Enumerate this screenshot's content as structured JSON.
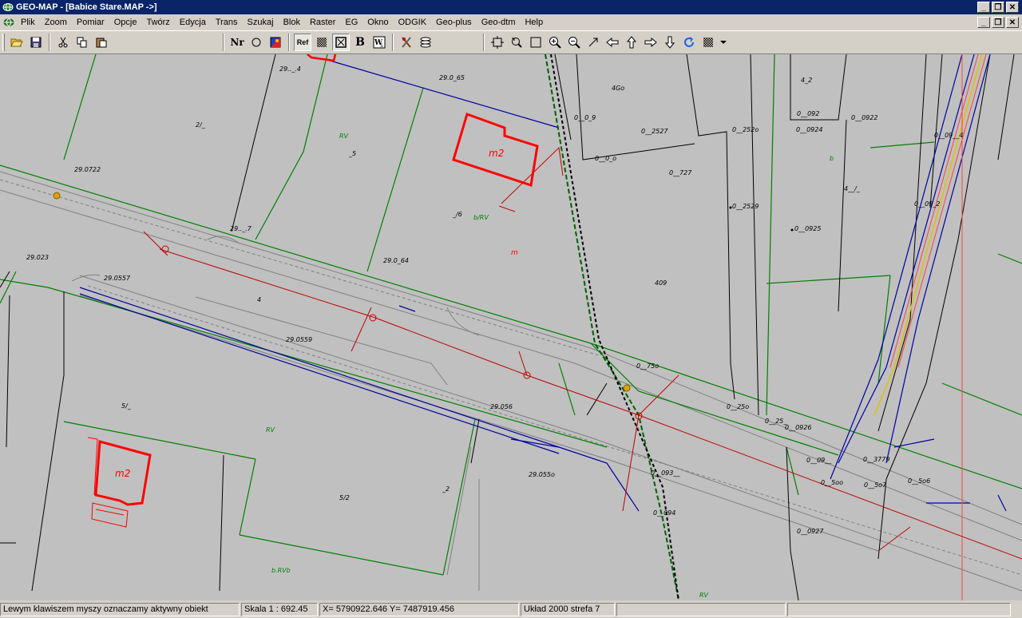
{
  "window": {
    "title": "GEO-MAP - [Babice Stare.MAP ->]"
  },
  "menu": [
    "Plik",
    "Zoom",
    "Pomiar",
    "Opcje",
    "Twórz",
    "Edycja",
    "Trans",
    "Szukaj",
    "Blok",
    "Raster",
    "EG",
    "Okno",
    "ODGIK",
    "Geo-plus",
    "Geo-dtm",
    "Help"
  ],
  "toolbar": {
    "nr_label": "Nr",
    "ref_label": "Ref",
    "b_label": "B"
  },
  "map_labels": {
    "p1": "29.._.4",
    "p2": "29.0_65",
    "p3": "2/_",
    "p4": "29.0722",
    "p5": "_5",
    "p6": "_/6",
    "p7": "29.0_64",
    "p8": "29.023",
    "p9": "29.0557",
    "p10": "29.0559",
    "p11": "4",
    "p12": "5/_",
    "p13": "5/2",
    "p14": "_2",
    "p15": "29.055o",
    "p16": "29.056",
    "p17": "409",
    "p18": "4Go",
    "p19": "0__0_9",
    "p20": "0__2527",
    "p21": "0__252o",
    "p22": "0__0_o",
    "p23": "0__727",
    "p24": "0__2529",
    "p25": "0__0925",
    "p26": "4_2",
    "p27": "0__092",
    "p28": "0__0924",
    "p29": "0__0922",
    "p30": "4__/_",
    "p31": "0__09__4",
    "p32": "0__09_2",
    "p33": "0__75o",
    "p34": "0__25o",
    "p35": "0__25_",
    "p36": "0__0926",
    "p37": "0__09__",
    "p38": "0__5oo",
    "p39": "0__5o7",
    "p40": "0__5o6",
    "p41": "0__3779",
    "p42": "0__0927",
    "p43": "0__094",
    "p44": "0__093__",
    "p45": "29.._.7"
  },
  "map_codes": {
    "rv": "RV",
    "brv": "b/RV",
    "b": "b",
    "m": "m",
    "m2a": "m2",
    "m2b": "m2",
    "brvb": "b.RVb",
    "rv2": "RV",
    "rv3": "RV"
  },
  "status": {
    "hint": "Lewym klawiszem myszy oznaczamy aktywny obiekt",
    "scale": "Skala 1 : 692.45",
    "coords": "X=  5790922.646  Y=  7487919.456",
    "system": "Układ 2000 strefa 7"
  },
  "colors": {
    "title_bg": "#0a246a",
    "map_bg": "#c0c0c0",
    "parcel_line": "#000000",
    "boundary_green": "#008000",
    "utility_red": "#c00000",
    "building_red": "#ff0000",
    "road_blue": "#0000a0"
  }
}
